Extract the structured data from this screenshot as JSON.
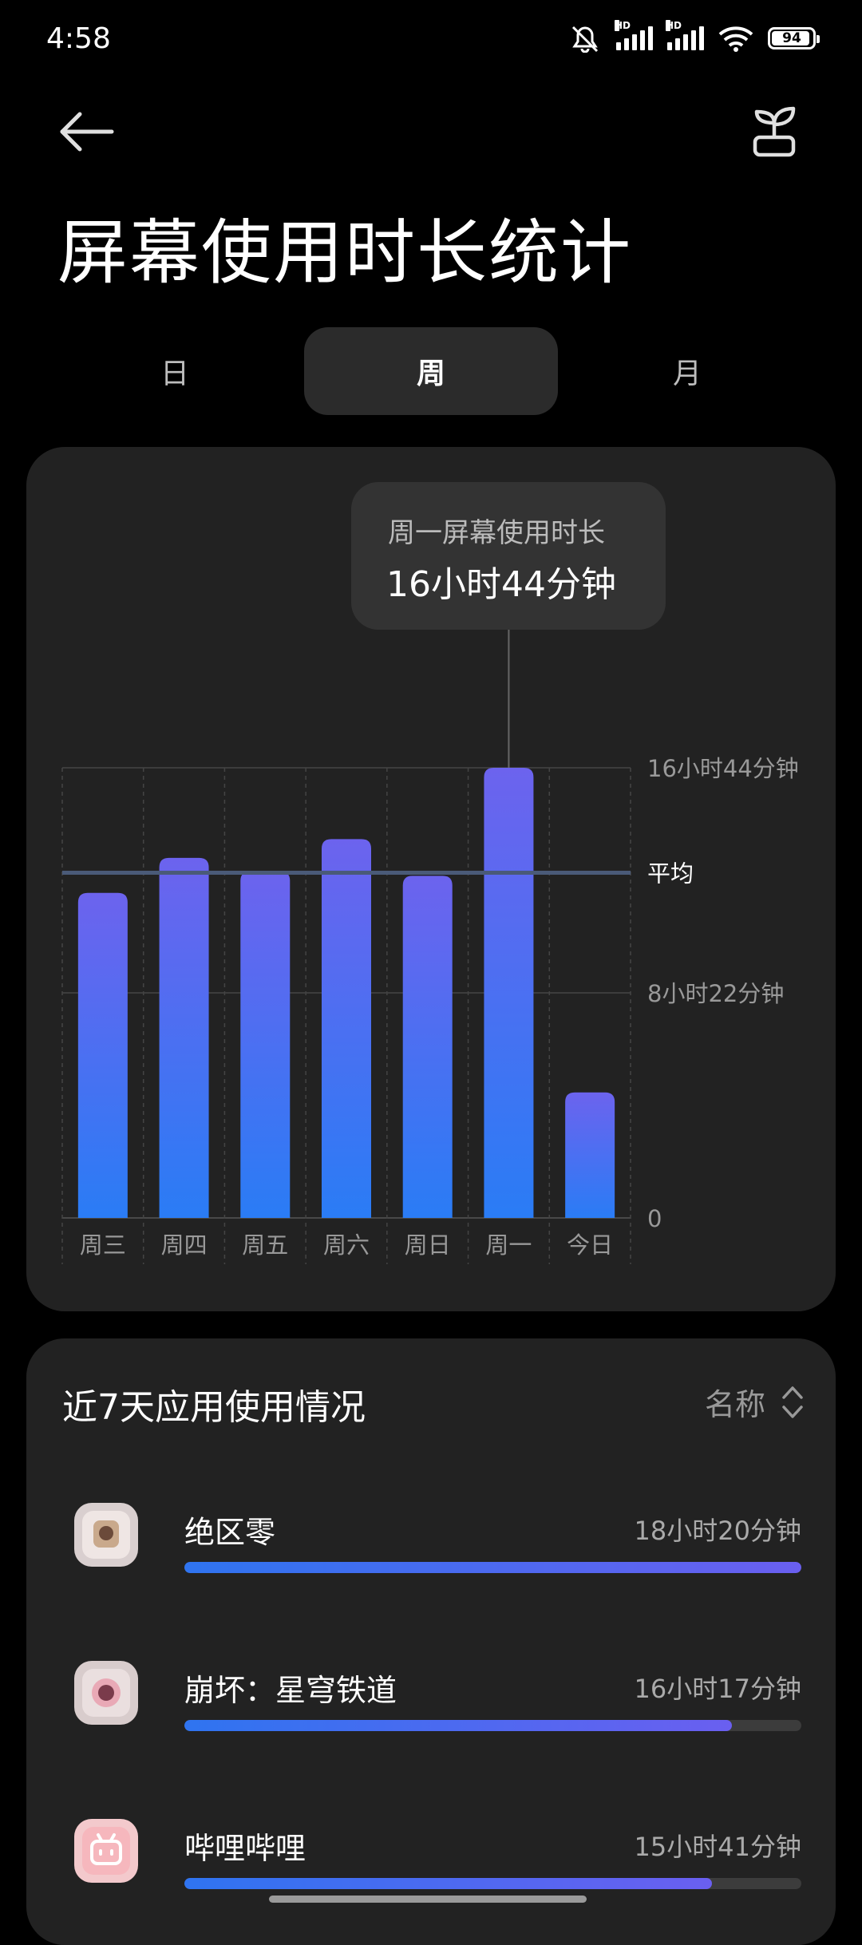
{
  "status_bar": {
    "time": "4:58",
    "battery": "94",
    "icons": [
      "mute-icon",
      "signal-hd-icon",
      "signal-hd-icon",
      "wifi-icon",
      "battery-icon"
    ]
  },
  "header": {
    "title": "屏幕使用时长统计",
    "back_icon": "arrow-left-icon",
    "right_icon": "sprout-icon"
  },
  "tabs": [
    {
      "label": "日",
      "active": false
    },
    {
      "label": "周",
      "active": true
    },
    {
      "label": "月",
      "active": false
    }
  ],
  "tooltip": {
    "label": "周一屏幕使用时长",
    "value": "16小时44分钟"
  },
  "chart_data": {
    "type": "bar",
    "categories": [
      "周三",
      "周四",
      "周五",
      "周六",
      "周日",
      "周一",
      "今日"
    ],
    "values_minutes": [
      725,
      803,
      773,
      845,
      763,
      1004,
      280
    ],
    "ylim_minutes": [
      0,
      1004
    ],
    "y_ticks": [
      {
        "label": "16小时44分钟",
        "value": 1004
      },
      {
        "label": "8小时22分钟",
        "value": 502
      },
      {
        "label": "0",
        "value": 0
      }
    ],
    "average_label": "平均",
    "average_minutes": 770,
    "highlighted_index": 5,
    "grid": true,
    "bar_gradient": [
      "#6c63ee",
      "#2a7cf5"
    ],
    "average_line_color": "#4a5a78"
  },
  "usage": {
    "title": "近7天应用使用情况",
    "sort_label": "名称",
    "apps": [
      {
        "name": "绝区零",
        "time": "18小时20分钟",
        "fraction": 1.0
      },
      {
        "name": "崩坏：星穹铁道",
        "time": "16小时17分钟",
        "fraction": 0.888
      },
      {
        "name": "哔哩哔哩",
        "time": "15小时41分钟",
        "fraction": 0.855
      }
    ]
  },
  "colors": {
    "background": "#000000",
    "card": "#222222",
    "accent_blue": "#2f74f0",
    "accent_purple": "#6a5ff0"
  }
}
